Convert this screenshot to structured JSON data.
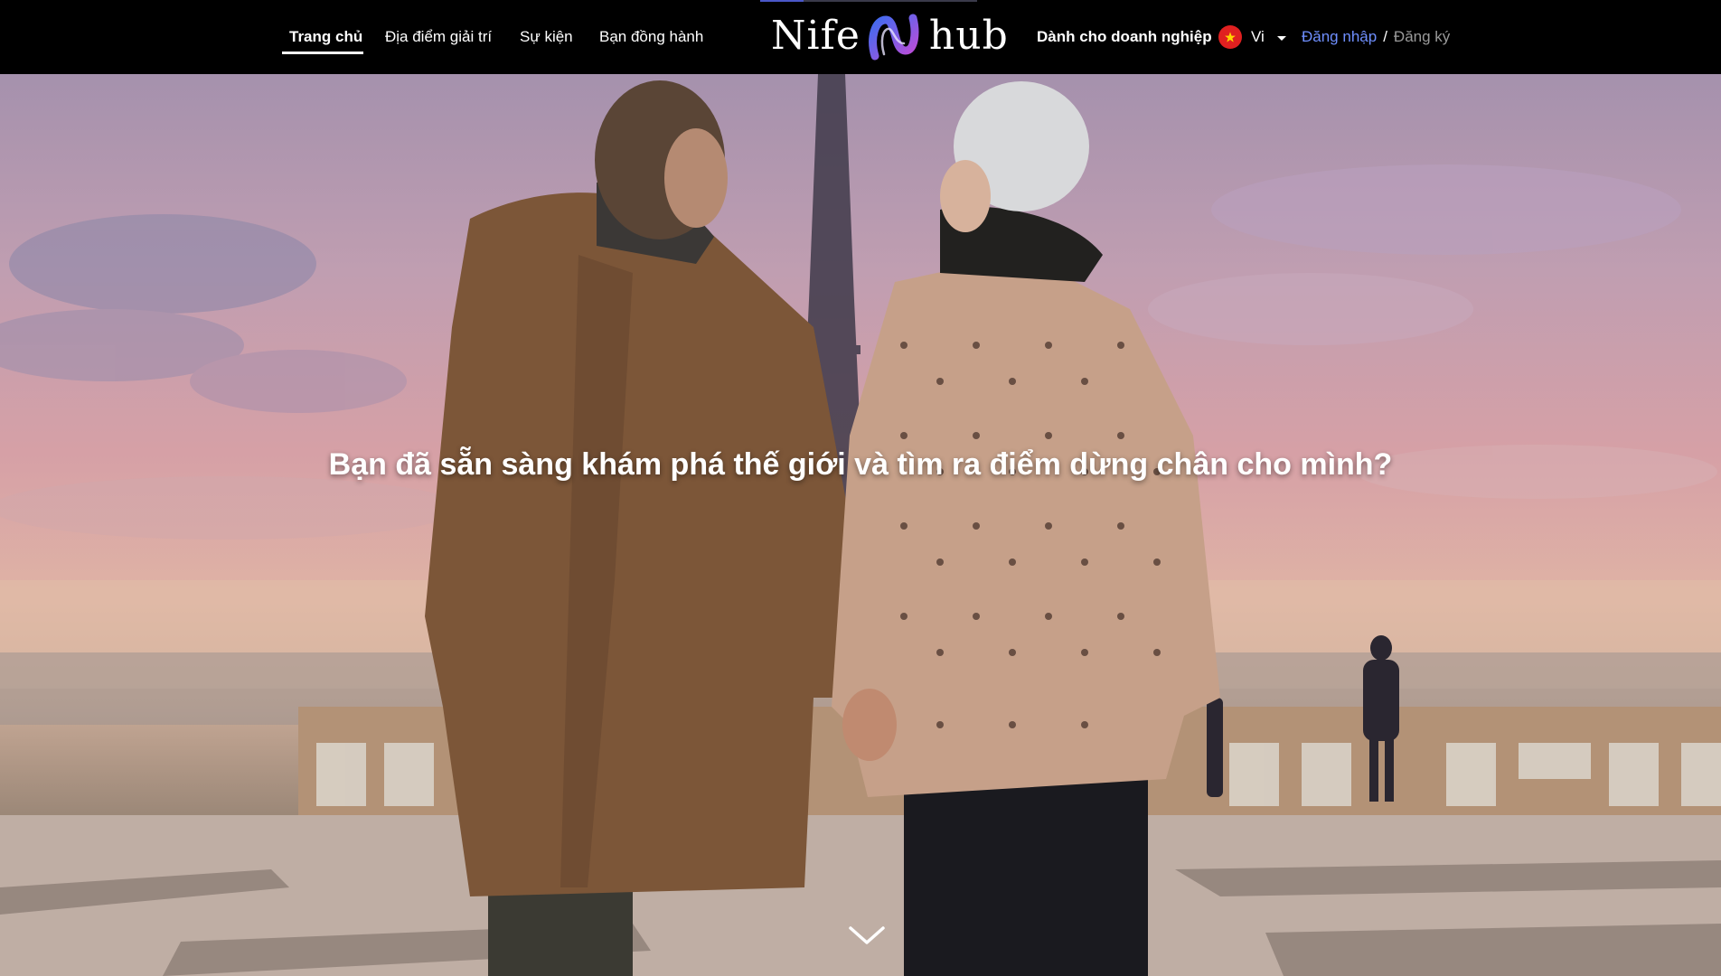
{
  "nav": {
    "items": [
      {
        "label": "Trang chủ",
        "active": true
      },
      {
        "label": "Địa điểm giải trí",
        "active": false
      },
      {
        "label": "Sự kiện",
        "active": false
      },
      {
        "label": "Bạn đồng hành",
        "active": false
      }
    ],
    "brand": {
      "left": "Nife",
      "right": "hub",
      "mark_icon": "nife-hub-logo-icon"
    },
    "business_link": "Dành cho doanh nghiệp",
    "language": {
      "selected": "Vi",
      "flag_icon": "vietnam-flag-icon"
    },
    "auth": {
      "login": "Đăng nhập",
      "separator": "/",
      "register": "Đăng ký"
    },
    "loading_progress": 0.2
  },
  "hero": {
    "headline": "Bạn đã sẵn sàng khám phá thế giới và tìm ra điểm dừng chân cho mình?",
    "scroll_icon": "chevron-down-icon",
    "background": "couple-at-eiffel-tower-photo"
  },
  "colors": {
    "nav_background": "#000000",
    "login_link": "#6f8fff",
    "register_link": "#9a9a9a",
    "logo_gradient_start": "#3d6cf0",
    "logo_gradient_end": "#c24bd6",
    "flag_red": "#e02020"
  }
}
